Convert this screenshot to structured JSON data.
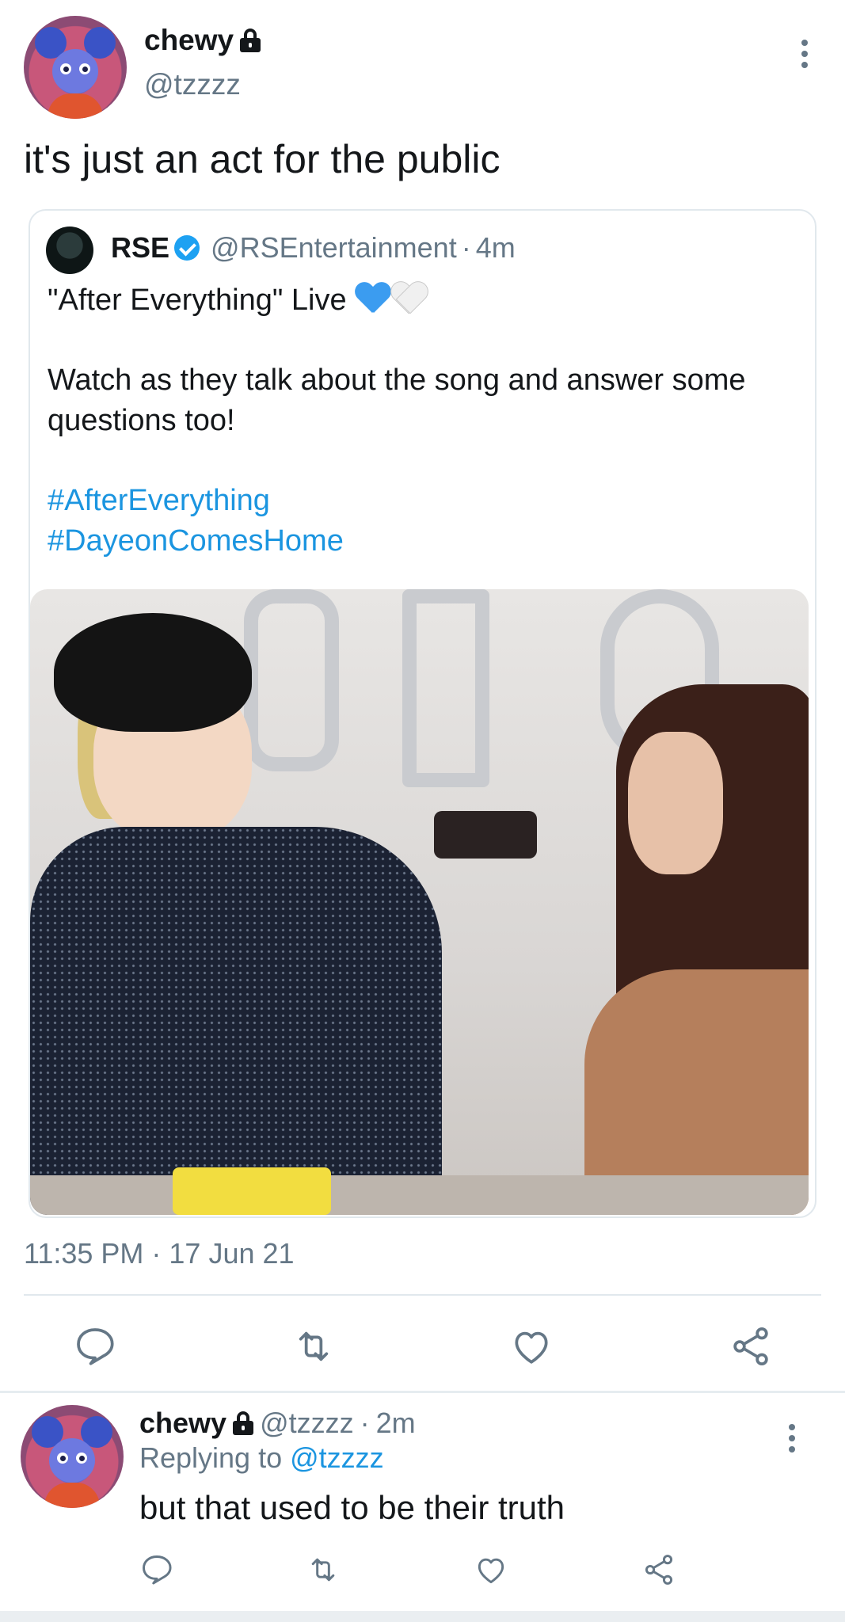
{
  "main_tweet": {
    "display_name": "chewy",
    "handle": "@tzzzz",
    "text": "it's just an act for the public",
    "timestamp": "11:35 PM · 17 Jun 21",
    "icons": {
      "lock": "lock-icon",
      "more": "more-vertical-icon"
    }
  },
  "quoted_tweet": {
    "display_name": "RSE",
    "handle": "@RSEntertainment",
    "separator": "·",
    "time": "4m",
    "line1": "\"After Everything\" Live",
    "line2": "Watch as they talk about the song and answer some questions too!",
    "hashtags": [
      "#AfterEverything",
      "#DayeonComesHome"
    ],
    "emoji": [
      "blue-heart",
      "white-heart"
    ],
    "verified": true
  },
  "actions": [
    "reply-icon",
    "retweet-icon",
    "like-icon",
    "share-icon"
  ],
  "reply_tweet": {
    "display_name": "chewy",
    "handle": "@tzzzz",
    "separator": "·",
    "time": "2m",
    "replying_prefix": "Replying to",
    "replying_to": "@tzzzz",
    "text": "but that used to be their truth"
  },
  "colors": {
    "text": "#14171a",
    "secondary": "#657786",
    "link": "#1b95e0",
    "verified": "#1da1f2",
    "border": "#e1e8ed"
  }
}
